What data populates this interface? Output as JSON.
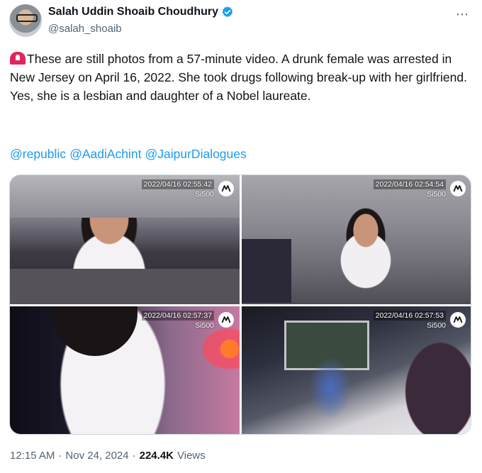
{
  "author": {
    "display_name": "Salah Uddin Shoaib Choudhury",
    "handle": "@salah_shoaib",
    "verified_icon": "verified-badge-icon",
    "verified_color": "#1d9bf0"
  },
  "more_icon": "⋯",
  "tweet": {
    "emoji": "rotating-light-icon",
    "text": "These are still photos from a 57-minute video. A drunk female was arrested in New Jersey on April 16, 2022. She took drugs following break-up with her girlfriend. Yes, she is a lesbian and daughter of a Nobel laureate.",
    "mentions": [
      "@republic",
      "@AadiAchint",
      "@JaipurDialogues"
    ]
  },
  "photos": [
    {
      "timestamp": "2022/04/16 02:55:42",
      "model": "Si500"
    },
    {
      "timestamp": "2022/04/16 02:54:54",
      "model": "Si500"
    },
    {
      "timestamp": "2022/04/16 02:57:37",
      "model": "Si500"
    },
    {
      "timestamp": "2022/04/16 02:57:53",
      "model": "Si500"
    }
  ],
  "meta": {
    "time": "12:15 AM",
    "sep1": "·",
    "date": "Nov 24, 2024",
    "sep2": "·",
    "views_count": "224.4K",
    "views_label": "Views"
  },
  "colors": {
    "text": "#0f1419",
    "secondary": "#536471",
    "link": "#1d9bf0"
  }
}
